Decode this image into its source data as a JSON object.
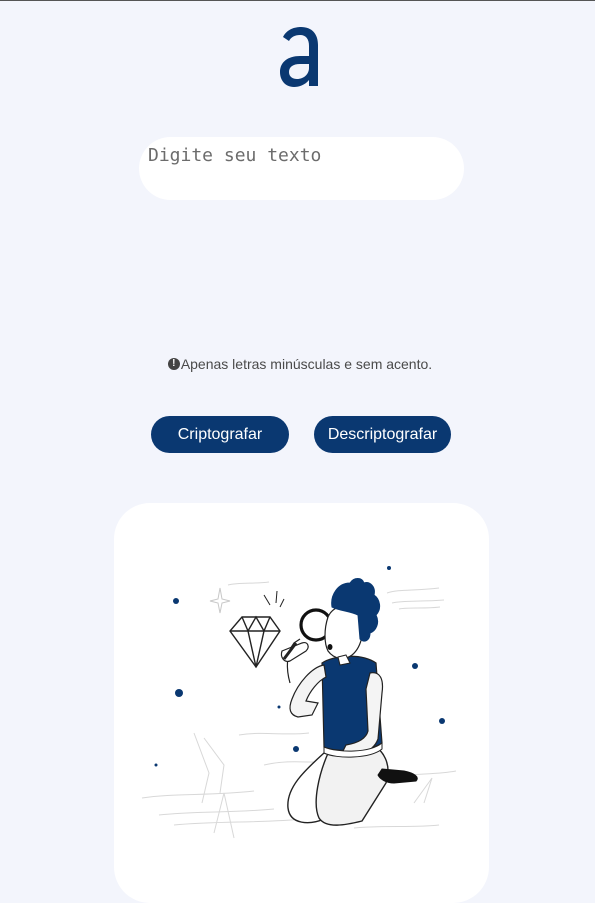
{
  "logo": {
    "icon": "alura-logo-icon",
    "color": "#0a3871"
  },
  "input": {
    "placeholder": "Digite seu texto",
    "value": ""
  },
  "hint": {
    "icon": "exclamation-circle-icon",
    "text": "Apenas letras minúsculas e sem acento."
  },
  "buttons": {
    "encrypt_label": "Criptografar",
    "decrypt_label": "Descriptografar"
  },
  "colors": {
    "background": "#f3f5fc",
    "accent": "#0a3871",
    "panel": "#ffffff"
  },
  "output_panel": {
    "illustration": "person-with-magnifying-glass-and-diamond"
  }
}
